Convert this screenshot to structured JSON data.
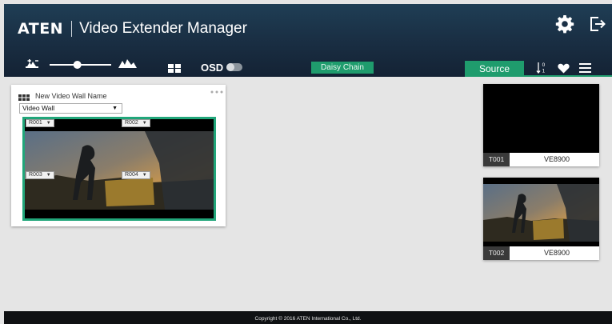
{
  "header": {
    "logo": "ATEN",
    "title": "Video Extender Manager",
    "osd_label": "OSD",
    "daisy_chain_label": "Daisy Chain",
    "source_tab_label": "Source",
    "icons": [
      "zoom-out-icon",
      "zoom-in-icon",
      "layout-icon",
      "gear-icon",
      "logout-icon",
      "sort-icon",
      "heart-icon",
      "menu-icon"
    ]
  },
  "toolbar": {
    "zoom_slider_level": 0.45,
    "osd_on": false
  },
  "video_wall": {
    "name": "New Video Wall Name",
    "type_value": "Video Wall",
    "receivers": [
      {
        "id": "R001",
        "caret": "▼"
      },
      {
        "id": "R002",
        "caret": "▼"
      },
      {
        "id": "R003",
        "caret": "▼"
      },
      {
        "id": "R004",
        "caret": "▼"
      }
    ]
  },
  "sources": [
    {
      "id": "T001",
      "model": "VE8900"
    },
    {
      "id": "T002",
      "model": "VE8900"
    }
  ],
  "footer": {
    "copyright": "Copyright © 2016 ATEN International Co., Ltd."
  },
  "colors": {
    "accent_green": "#1f9c6d",
    "header_dark": "#1a3045",
    "workspace": "#e5e5e5"
  }
}
